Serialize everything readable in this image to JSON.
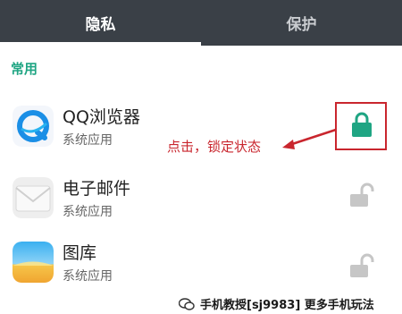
{
  "tabs": {
    "privacy_label": "隐私",
    "protect_label": "保护"
  },
  "section": {
    "title": "常用"
  },
  "apps": [
    {
      "name": "QQ浏览器",
      "subtitle": "系统应用",
      "icon": "qq-browser-icon",
      "locked": true
    },
    {
      "name": "电子邮件",
      "subtitle": "系统应用",
      "icon": "email-icon",
      "locked": false
    },
    {
      "name": "图库",
      "subtitle": "系统应用",
      "icon": "gallery-icon",
      "locked": false
    }
  ],
  "annotation": {
    "text": "点击，锁定状态"
  },
  "watermark": {
    "text": "手机教授[sj9983] 更多手机玩法",
    "icon": "wechat-icon"
  },
  "colors": {
    "tab_bar": "#3a4047",
    "accent": "#1fa583",
    "annotation_red": "#c9262e",
    "unlocked_gray": "#c6c6c6"
  }
}
